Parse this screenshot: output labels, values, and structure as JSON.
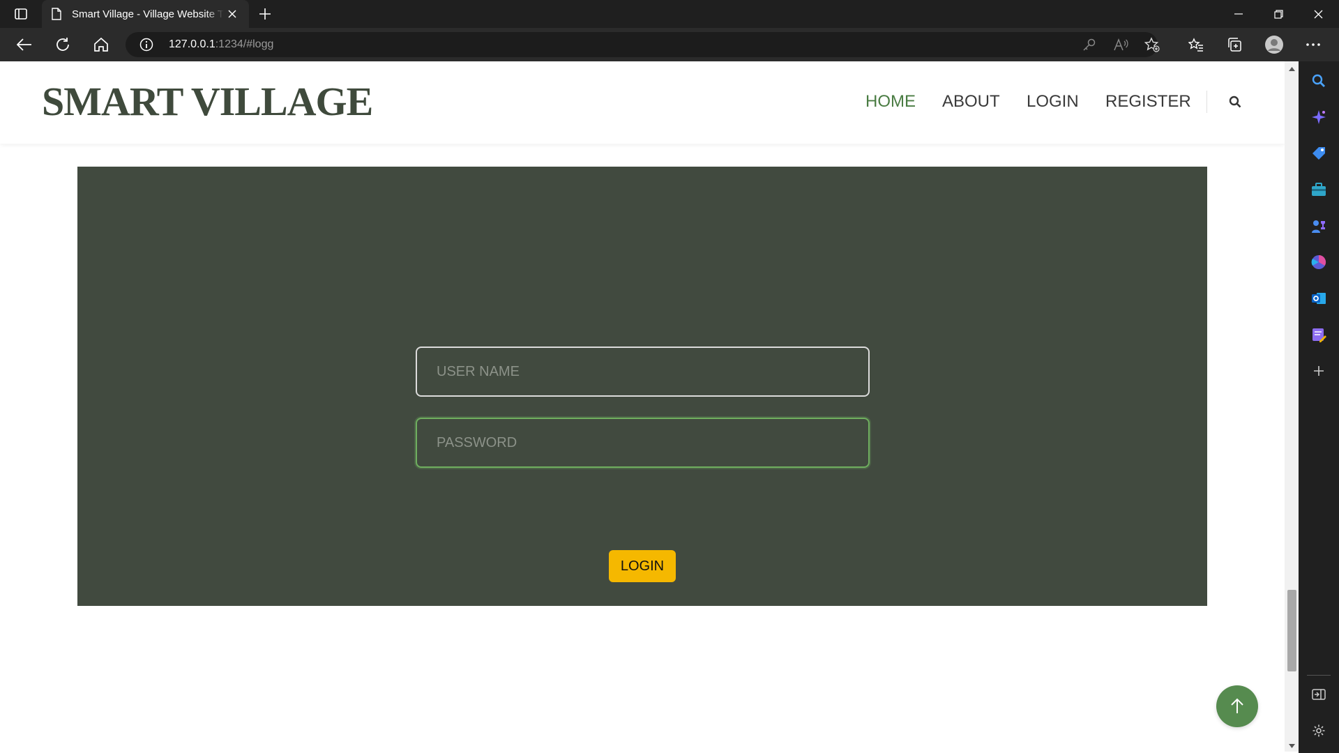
{
  "browser": {
    "tab_title": "Smart Village - Village Website Template",
    "url_host": "127.0.0.1",
    "url_rest": ":1234/#logg"
  },
  "site": {
    "brand": "SMART VILLAGE",
    "nav": [
      "HOME",
      "ABOUT",
      "LOGIN",
      "REGISTER"
    ],
    "active_nav": "HOME"
  },
  "login": {
    "username_placeholder": "USER NAME",
    "password_placeholder": "PASSWORD",
    "submit_label": "LOGIN"
  },
  "colors": {
    "panel": "#414a3f",
    "accent_green": "#4a7c43",
    "button_yellow": "#f5b800",
    "brand_text": "#3f4a3c"
  },
  "icons": [
    "tab-actions-icon",
    "page-icon",
    "close-icon",
    "plus-icon",
    "minimize-icon",
    "restore-icon",
    "back-arrow-icon",
    "refresh-icon",
    "home-icon",
    "info-icon",
    "key-icon",
    "read-aloud-icon",
    "favorite-add-icon",
    "favorites-icon",
    "collections-icon",
    "profile-icon",
    "more-icon",
    "search-icon",
    "arrow-up-icon"
  ]
}
